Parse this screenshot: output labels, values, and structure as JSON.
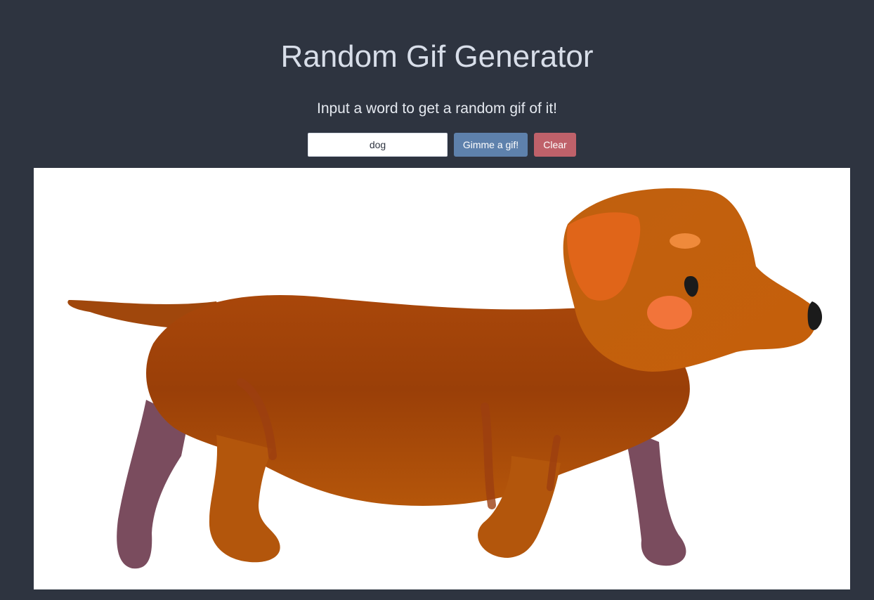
{
  "page": {
    "title": "Random Gif Generator",
    "subtitle": "Input a word to get a random gif of it!"
  },
  "search": {
    "value": "dog",
    "placeholder": ""
  },
  "buttons": {
    "gimme_label": "Gimme a gif!",
    "clear_label": "Clear"
  },
  "gif": {
    "alt": "dog",
    "subject": "cartoon dachshund dog walking"
  },
  "colors": {
    "background": "#2e3440",
    "text": "#d8dee9",
    "gimme_button": "#5e81ac",
    "clear_button": "#bf616a",
    "dog_body": "#b24d07",
    "dog_ear": "#e4681b",
    "dog_legs_back": "#7a4c5e"
  }
}
